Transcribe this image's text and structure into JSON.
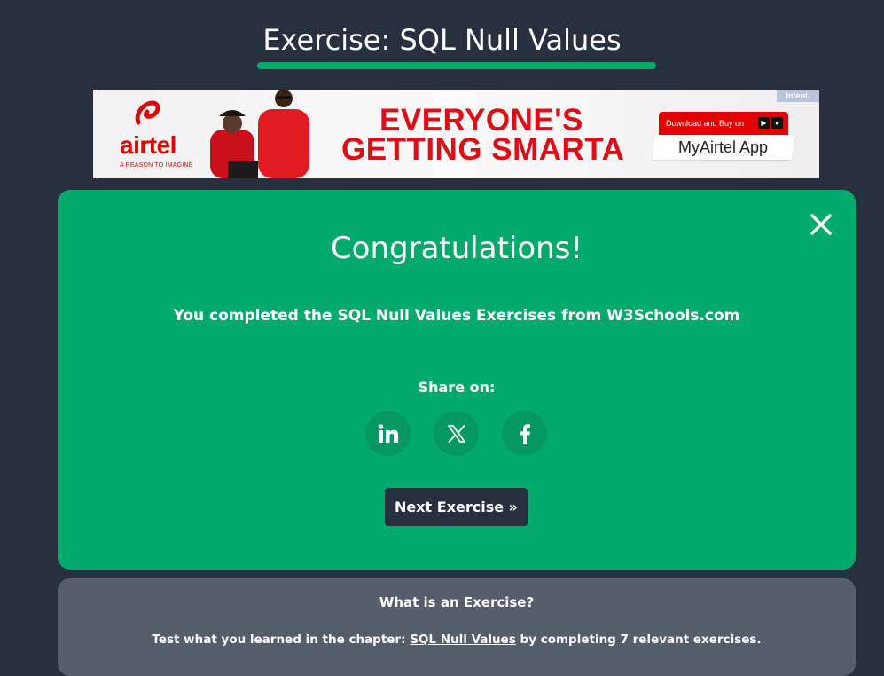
{
  "page": {
    "title": "Exercise: SQL Null Values",
    "accent_color": "#04aa6d",
    "background_color": "#282f3e"
  },
  "ad": {
    "tag": "Intent.",
    "brand": "airtel",
    "brand_tagline": "A REASON TO IMAGINE",
    "headline_line1": "EVERYONE'S",
    "headline_line2": "GETTING SMARTA",
    "cta_top": "Download and Buy on",
    "cta_bottom": "MyAirtel App",
    "brand_color": "#e40000"
  },
  "congrats": {
    "title": "Congratulations!",
    "message": "You completed the SQL Null Values Exercises from W3Schools.com",
    "share_label": "Share on:",
    "share_icons": [
      "linkedin-icon",
      "x-twitter-icon",
      "facebook-icon"
    ],
    "next_button": "Next Exercise »",
    "close_icon": "close-icon"
  },
  "info": {
    "title": "What is an Exercise?",
    "text_before": "Test what you learned in the chapter: ",
    "link": "SQL Null Values",
    "text_after": " by completing 7 relevant exercises."
  }
}
